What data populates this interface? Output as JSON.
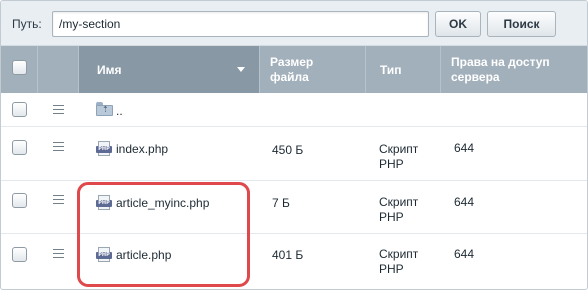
{
  "pathbar": {
    "label": "Путь:",
    "value": "/my-section",
    "ok_label": "OK",
    "search_label": "Поиск"
  },
  "table": {
    "columns": {
      "name": "Имя",
      "size": "Размер файла",
      "type": "Тип",
      "rights": "Права на доступ сервера"
    },
    "up_row": {
      "name": "..",
      "icon": "folder-up-icon"
    },
    "rows": [
      {
        "name": "index.php",
        "size": "450 Б",
        "type": "Скрипт PHP",
        "rights": "644",
        "icon": "php-file-icon"
      },
      {
        "name": "article_myinc.php",
        "size": "7 Б",
        "type": "Скрипт PHP",
        "rights": "644",
        "icon": "php-file-icon"
      },
      {
        "name": "article.php",
        "size": "401 Б",
        "type": "Скрипт PHP",
        "rights": "644",
        "icon": "php-file-icon"
      }
    ]
  },
  "icon_text": {
    "php": "PHP",
    "up_arrow": "⇡"
  },
  "colors": {
    "header_bg": "#a2b0bb",
    "sorted_header_bg": "#8898a5",
    "highlight_border": "#e0494b",
    "pathbar_bg": "#e9eef2"
  }
}
